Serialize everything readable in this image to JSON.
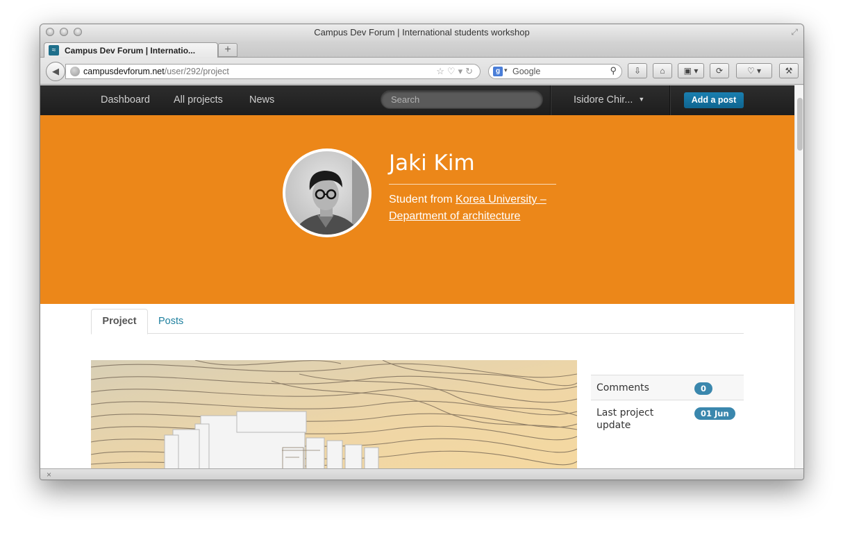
{
  "browser": {
    "window_title": "Campus Dev Forum | International students workshop",
    "tab_title": "Campus Dev Forum | Internatio...",
    "url_host": "campusdevforum.net",
    "url_path": "/user/292/project",
    "search_engine": "Google"
  },
  "site_nav": {
    "links": [
      "Dashboard",
      "All projects",
      "News"
    ],
    "search_placeholder": "Search",
    "user_name": "Isidore Chir...",
    "add_post_label": "Add a post"
  },
  "profile": {
    "name": "Jaki Kim",
    "desc_prefix": "Student from ",
    "university": "Korea University – Department of architecture"
  },
  "tabs": [
    "Project",
    "Posts"
  ],
  "project_info": {
    "rows": [
      {
        "label": "Comments",
        "value": "0"
      },
      {
        "label": "Last project update",
        "value": "01 Jun"
      }
    ]
  },
  "colors": {
    "hero": "#ec8719",
    "nav_bg": "#222222",
    "accent_button": "#1a7fb0",
    "badge": "#3a87ad",
    "tab_link": "#1e7f9e"
  }
}
